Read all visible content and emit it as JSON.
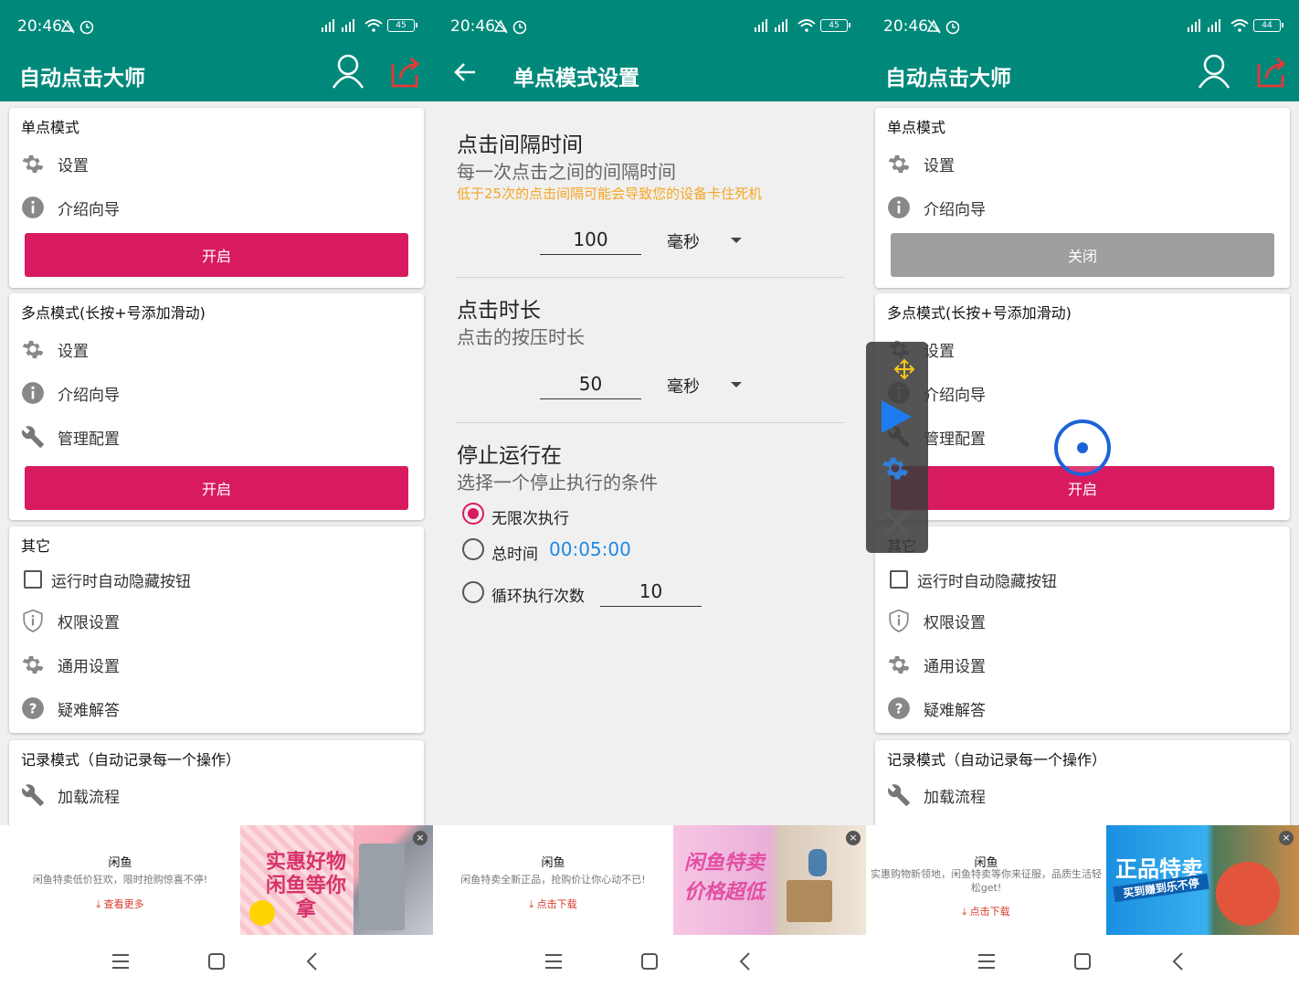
{
  "status": {
    "time": "20:46",
    "battery_p1": "45",
    "battery_p2": "45",
    "battery_p3": "44"
  },
  "app_title": "自动点击大师",
  "main": {
    "single": {
      "title": "单点模式",
      "settings": "设置",
      "guide": "介绍向导",
      "start": "开启",
      "stop": "关闭"
    },
    "multi": {
      "title": "多点模式(长按+号添加滑动)",
      "settings": "设置",
      "guide": "介绍向导",
      "manage": "管理配置",
      "start": "开启"
    },
    "other": {
      "title": "其它",
      "autohide": "运行时自动隐藏按钮",
      "permission": "权限设置",
      "general": "通用设置",
      "faq": "疑难解答"
    },
    "record": {
      "title": "记录模式（自动记录每一个操作）",
      "load": "加载流程"
    }
  },
  "settings_page": {
    "title": "单点模式设置",
    "interval": {
      "title": "点击间隔时间",
      "subtitle": "每一次点击之间的间隔时间",
      "warning": "低于25次的点击间隔可能会导致您的设备卡住死机",
      "value": "100",
      "unit": "毫秒"
    },
    "duration": {
      "title": "点击时长",
      "subtitle": "点击的按压时长",
      "value": "50",
      "unit": "毫秒"
    },
    "stop": {
      "title": "停止运行在",
      "subtitle": "选择一个停止执行的条件",
      "opt_infinite": "无限次执行",
      "opt_total": "总时间",
      "total_time": "00:05:00",
      "opt_loop": "循环执行次数",
      "loop_count": "10"
    }
  },
  "ads": [
    {
      "brand": "闲鱼",
      "desc": "闲鱼特卖低价狂欢，限时抢购惊喜不停!",
      "cta": "查看更多",
      "slogan": "实惠好物 闲鱼等你拿"
    },
    {
      "brand": "闲鱼",
      "desc": "闲鱼特卖全新正品，抢购价让你心动不已!",
      "cta": "点击下载",
      "slogan": "闲鱼特卖 价格超低"
    },
    {
      "brand": "闲鱼",
      "desc": "实惠购物新领地，闲鱼特卖等你来征服，品质生活轻松get!",
      "cta": "点击下载",
      "slogan": "正品特卖",
      "slogan2": "买到赚到乐不停"
    }
  ],
  "colors": {
    "appbar": "#00897b",
    "accent": "#d81b60",
    "disabled": "#9e9e9e",
    "link": "#1e88e5",
    "warning": "#f5a623"
  }
}
